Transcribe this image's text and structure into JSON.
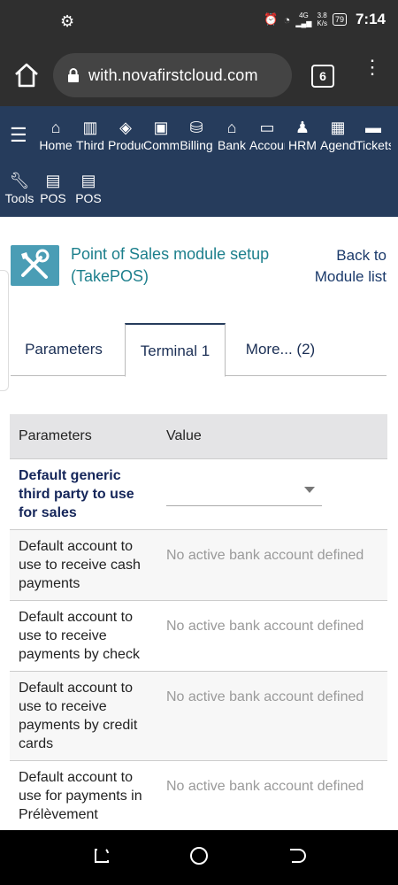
{
  "status_bar": {
    "time": "7:14",
    "network_type": "4G",
    "speed_value": "3.8",
    "speed_unit": "K/s",
    "battery": "79"
  },
  "browser": {
    "url": "with.novafirstcloud.com",
    "tab_count": "6"
  },
  "topnav": {
    "items": [
      {
        "label": "Home",
        "icon": "home-icon"
      },
      {
        "label": "Third",
        "icon": "building-icon"
      },
      {
        "label": "Products",
        "icon": "cube-icon"
      },
      {
        "label": "Commerce",
        "icon": "briefcase-icon"
      },
      {
        "label": "Billing",
        "icon": "coins-icon"
      },
      {
        "label": "Bank",
        "icon": "bank-icon"
      },
      {
        "label": "Accounting",
        "icon": "money-icon"
      },
      {
        "label": "HRM",
        "icon": "user-tie-icon"
      },
      {
        "label": "Agenda",
        "icon": "calendar-icon"
      },
      {
        "label": "Tickets",
        "icon": "ticket-icon"
      },
      {
        "label": "Tools",
        "icon": "wrench-icon"
      },
      {
        "label": "POS",
        "icon": "cash-register-icon"
      },
      {
        "label": "POS",
        "icon": "cash-register-icon"
      }
    ]
  },
  "page": {
    "title": "Point of Sales module setup (TakePOS)",
    "back_link": "Back to Module list"
  },
  "tabs": [
    {
      "label": "Parameters"
    },
    {
      "label": "Terminal 1"
    },
    {
      "label": "More... (2)"
    }
  ],
  "table": {
    "headers": [
      "Parameters",
      "Value"
    ],
    "rows": [
      {
        "label": "Default generic third party to use for sales",
        "value": "",
        "type": "select"
      },
      {
        "label": "Default account to use to receive cash payments",
        "value": "No active bank account defined"
      },
      {
        "label": "Default account to use to receive payments by check",
        "value": "No active bank account defined"
      },
      {
        "label": "Default account to use to receive payments by credit cards",
        "value": "No active bank account defined"
      },
      {
        "label": "Default account to use for payments in Prélèvement",
        "value": "No active bank account defined"
      }
    ]
  },
  "colors": {
    "nav_bg": "#263c5c",
    "title_color": "#1c7f8c",
    "icon_bg": "#4a9db5",
    "link_color": "#1b3a6b"
  }
}
